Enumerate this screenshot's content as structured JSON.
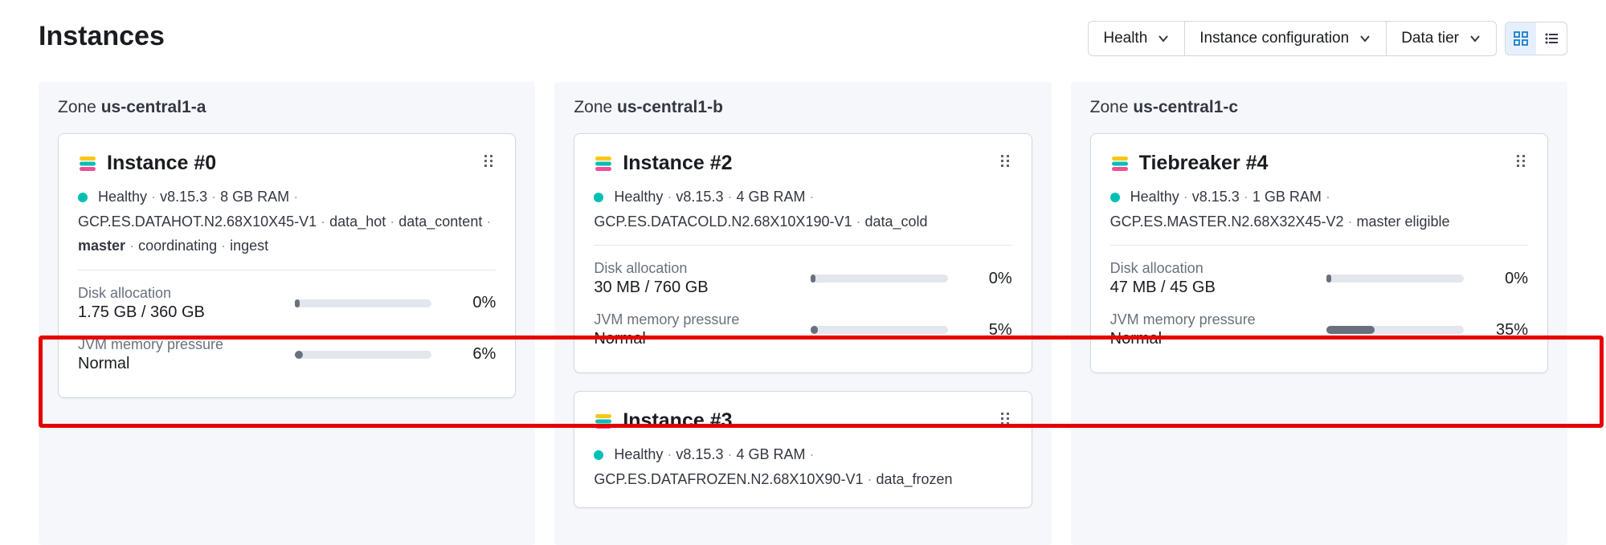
{
  "page": {
    "title": "Instances"
  },
  "toolbar": {
    "selects": [
      {
        "label": "Health"
      },
      {
        "label": "Instance configuration"
      },
      {
        "label": "Data tier"
      }
    ]
  },
  "zones": [
    {
      "zone_label": "Zone",
      "zone_name": "us-central1-a",
      "cards": [
        {
          "title": "Instance #0",
          "health": "Healthy",
          "version": "v8.15.3",
          "ram": "8 GB RAM",
          "config": "GCP.ES.DATAHOT.N2.68X10X45-V1",
          "tags": [
            {
              "text": "data_hot",
              "bold": false
            },
            {
              "text": "data_content",
              "bold": false
            },
            {
              "text": "master",
              "bold": true
            },
            {
              "text": "coordinating",
              "bold": false
            },
            {
              "text": "ingest",
              "bold": false
            }
          ],
          "disk": {
            "label": "Disk allocation",
            "value": "1.75 GB / 360 GB",
            "pct": "0%",
            "fill": 0
          },
          "jvm": {
            "label": "JVM memory pressure",
            "value": "Normal",
            "pct": "6%",
            "fill": 6
          }
        }
      ]
    },
    {
      "zone_label": "Zone",
      "zone_name": "us-central1-b",
      "cards": [
        {
          "title": "Instance #2",
          "health": "Healthy",
          "version": "v8.15.3",
          "ram": "4 GB RAM",
          "config": "GCP.ES.DATACOLD.N2.68X10X190-V1",
          "tags": [
            {
              "text": "data_cold",
              "bold": false
            }
          ],
          "disk": {
            "label": "Disk allocation",
            "value": "30 MB / 760 GB",
            "pct": "0%",
            "fill": 0
          },
          "jvm": {
            "label": "JVM memory pressure",
            "value": "Normal",
            "pct": "5%",
            "fill": 5
          }
        },
        {
          "title": "Instance #3",
          "health": "Healthy",
          "version": "v8.15.3",
          "ram": "4 GB RAM",
          "config": "GCP.ES.DATAFROZEN.N2.68X10X90-V1",
          "tags": [
            {
              "text": "data_frozen",
              "bold": false
            }
          ],
          "disk": null,
          "jvm": null
        }
      ]
    },
    {
      "zone_label": "Zone",
      "zone_name": "us-central1-c",
      "cards": [
        {
          "title": "Tiebreaker #4",
          "health": "Healthy",
          "version": "v8.15.3",
          "ram": "1 GB RAM",
          "config": "GCP.ES.MASTER.N2.68X32X45-V2",
          "tags": [
            {
              "text": "master eligible",
              "bold": false
            }
          ],
          "disk": {
            "label": "Disk allocation",
            "value": "47 MB / 45 GB",
            "pct": "0%",
            "fill": 0
          },
          "jvm": {
            "label": "JVM memory pressure",
            "value": "Normal",
            "pct": "35%",
            "fill": 35
          }
        }
      ]
    }
  ]
}
